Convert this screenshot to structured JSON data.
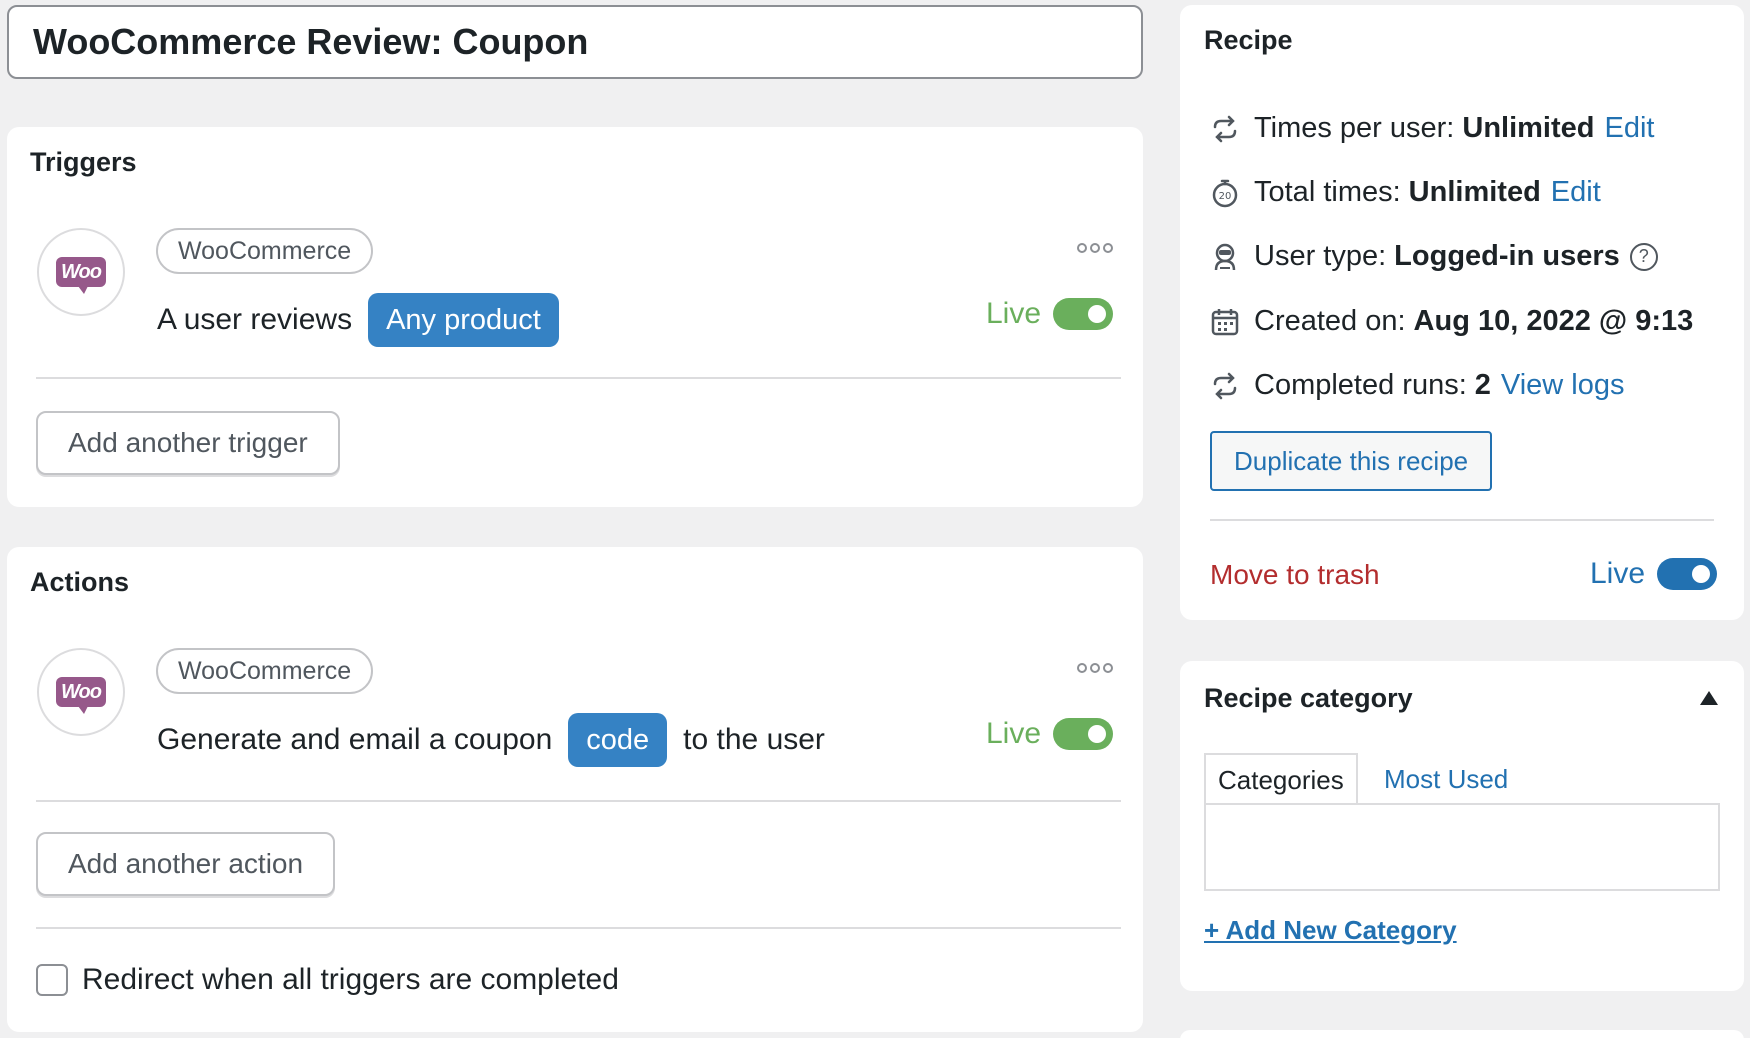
{
  "recipe_title": "WooCommerce Review: Coupon",
  "triggers": {
    "heading": "Triggers",
    "item": {
      "integration": "WooCommerce",
      "sentence_prefix": "A user reviews",
      "token": "Any product",
      "status": "Live"
    },
    "add_button": "Add another trigger"
  },
  "actions": {
    "heading": "Actions",
    "item": {
      "integration": "WooCommerce",
      "sentence_prefix": "Generate and email a coupon",
      "token": "code",
      "sentence_suffix": "to the user",
      "status": "Live"
    },
    "add_button": "Add another action",
    "redirect_label": "Redirect when all triggers are completed"
  },
  "recipe": {
    "heading": "Recipe",
    "times_per_user_label": "Times per user:",
    "times_per_user_value": "Unlimited",
    "total_times_label": "Total times:",
    "total_times_value": "Unlimited",
    "edit_link": "Edit",
    "user_type_label": "User type:",
    "user_type_value": "Logged-in users",
    "created_label": "Created on:",
    "created_value": "Aug 10, 2022 @ 9:13",
    "runs_label": "Completed runs:",
    "runs_value": "2",
    "view_logs": "View logs",
    "duplicate_button": "Duplicate this recipe",
    "trash_link": "Move to trash",
    "status": "Live"
  },
  "category": {
    "heading": "Recipe category",
    "tab_categories": "Categories",
    "tab_most_used": "Most Used",
    "add_new": "+ Add New Category"
  },
  "colors": {
    "live_green": "#6aaf5c",
    "live_blue": "#2271b1",
    "token_blue": "#3582c4",
    "trash_red": "#b32d2e",
    "woo_purple": "#96588a"
  },
  "icons": [
    "refresh-icon",
    "stopwatch-icon",
    "user-robot-icon",
    "calendar-icon",
    "more-options-icon",
    "woocommerce-logo",
    "help-icon",
    "caret-up-icon"
  ]
}
